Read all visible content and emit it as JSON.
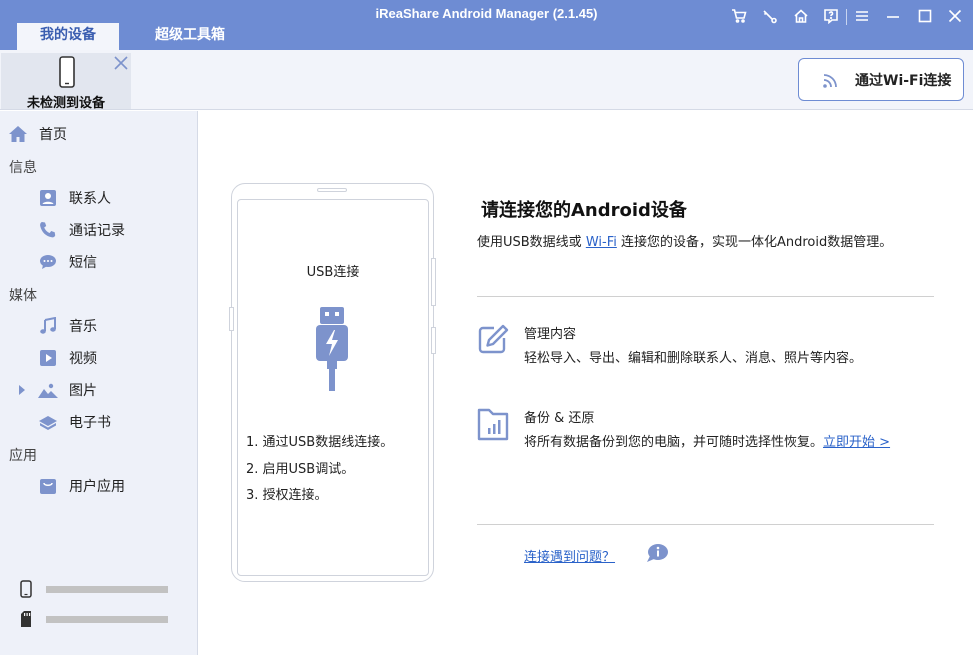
{
  "app": {
    "title": "iReaShare Android Manager (2.1.45)"
  },
  "tabs": [
    {
      "label": "我的设备"
    },
    {
      "label": "超级工具箱"
    }
  ],
  "window_controls": [
    "cart-icon",
    "key-icon",
    "home-icon",
    "help-icon",
    "menu-icon",
    "minimize-icon",
    "maximize-icon",
    "close-icon"
  ],
  "device": {
    "status": "未检测到设备"
  },
  "wifi_button": {
    "label": "通过Wi-Fi连接"
  },
  "sidebar": {
    "home": "首页",
    "sections": {
      "info": "信息",
      "media": "媒体",
      "apps": "应用"
    },
    "items": {
      "contacts": "联系人",
      "call_log": "通话记录",
      "sms": "短信",
      "music": "音乐",
      "video": "视频",
      "photos": "图片",
      "ebooks": "电子书",
      "user_apps": "用户应用"
    }
  },
  "main": {
    "usb_title": "USB连接",
    "steps": [
      "1. 通过USB数据线连接。",
      "2. 启用USB调试。",
      "3. 授权连接。"
    ],
    "heading": "请连接您的Android设备",
    "desc_prefix": "使用USB数据线或 ",
    "desc_link": "Wi-Fi",
    "desc_suffix": " 连接您的设备，实现一体化Android数据管理。",
    "features": [
      {
        "title": "管理内容",
        "desc": "轻松导入、导出、编辑和删除联系人、消息、照片等内容。"
      },
      {
        "title": "备份 & 还原",
        "desc": "将所有数据备份到您的电脑，并可随时选择性恢复。",
        "link": "立即开始 >"
      }
    ],
    "problem_link": "连接遇到问题？"
  },
  "colors": {
    "accent": "#6e8cd3",
    "icon": "#7d93cc",
    "link": "#2a62c9"
  }
}
